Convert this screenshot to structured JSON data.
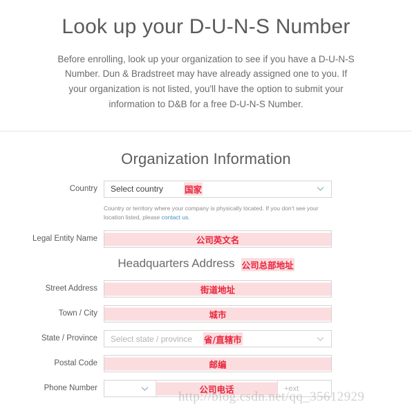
{
  "hero": {
    "title": "Look up your D-U-N-S Number",
    "description": "Before enrolling, look up your organization to see if you have a D-U-N-S Number. Dun & Bradstreet may have already assigned one to you. If your organization is not listed, you'll have the option to submit your information to D&B for a free D-U-N-S Number."
  },
  "form": {
    "section_title": "Organization Information",
    "subsection_title": "Headquarters Address",
    "subsection_annotation": "公司总部地址",
    "fields": {
      "country": {
        "label": "Country",
        "placeholder": "Select country",
        "annotation": "国家",
        "helper_prefix": "Country or territory where your company is physically located. If you don't see your location listed, please ",
        "helper_link": "contact us",
        "helper_suffix": "."
      },
      "legal_entity_name": {
        "label": "Legal Entity Name",
        "value": "",
        "annotation": "公司英文名"
      },
      "street_address": {
        "label": "Street Address",
        "value": "",
        "annotation": "街道地址"
      },
      "town_city": {
        "label": "Town / City",
        "value": "",
        "annotation": "城市"
      },
      "state_province": {
        "label": "State / Province",
        "placeholder": "Select state / province",
        "annotation": "省/直辖市"
      },
      "postal_code": {
        "label": "Postal Code",
        "value": "",
        "annotation": "邮编"
      },
      "phone_number": {
        "label": "Phone Number",
        "country_code": "",
        "value": "",
        "ext_placeholder": "+ext",
        "annotation": "公司电话"
      }
    }
  },
  "watermark": {
    "text": "http://blog.csdn.net/qq_35612929"
  },
  "colors": {
    "annotation_text": "#e8253c",
    "annotation_bg": "#fbdcdf",
    "link": "#3b93c4",
    "chevron_active": "#8ab7cc",
    "chevron_disabled": "#c6c6c6",
    "border": "#d4d4d4"
  }
}
